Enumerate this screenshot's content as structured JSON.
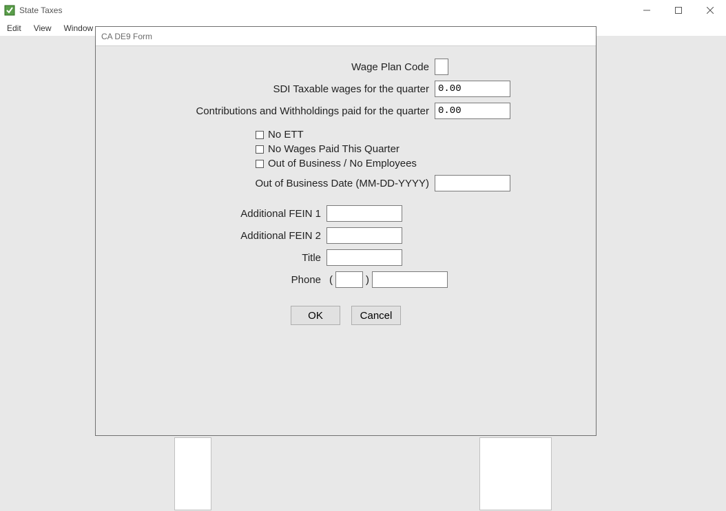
{
  "window": {
    "title": "State Taxes"
  },
  "menu": {
    "edit": "Edit",
    "view": "View",
    "window": "Window"
  },
  "dialog": {
    "title": "CA DE9 Form",
    "labels": {
      "wage_plan_code": "Wage Plan Code",
      "sdi_taxable": "SDI Taxable wages for the quarter",
      "contributions": "Contributions and Withholdings paid for the quarter",
      "no_ett": "No ETT",
      "no_wages": "No Wages Paid This Quarter",
      "out_of_business": "Out of Business / No Employees",
      "oob_date": "Out of Business Date (MM-DD-YYYY)",
      "fein1": "Additional FEIN 1",
      "fein2": "Additional FEIN 2",
      "title_field": "Title",
      "phone": "Phone"
    },
    "values": {
      "wage_plan_code": "",
      "sdi_taxable": "0.00",
      "contributions": "0.00",
      "oob_date": "",
      "fein1": "",
      "fein2": "",
      "title_field": "",
      "phone_area": "",
      "phone_number": ""
    },
    "buttons": {
      "ok": "OK",
      "cancel": "Cancel"
    }
  }
}
